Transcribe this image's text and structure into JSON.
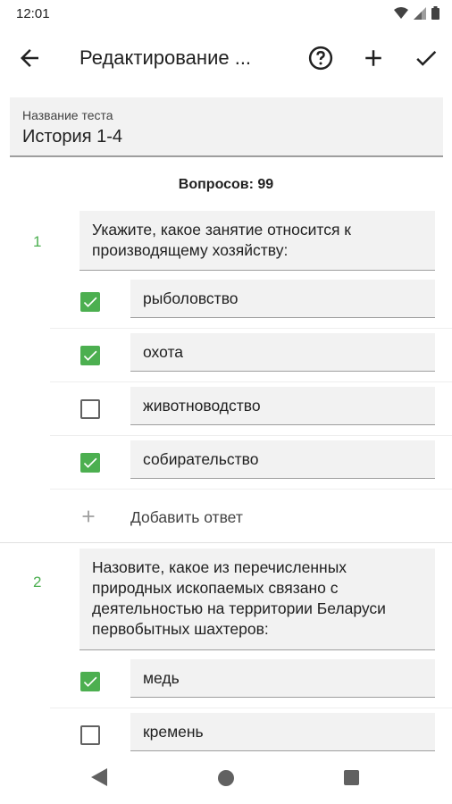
{
  "status_bar": {
    "time": "12:01"
  },
  "app_bar": {
    "title": "Редактирование ..."
  },
  "test_name": {
    "label": "Название теста",
    "value": "История 1-4"
  },
  "question_count": "Вопросов: 99",
  "questions": [
    {
      "number": "1",
      "text": "Укажите, какое занятие относится к производящему хозяйству:",
      "answers": [
        {
          "text": "рыболовство",
          "checked": true
        },
        {
          "text": "охота",
          "checked": true
        },
        {
          "text": "животноводство",
          "checked": false
        },
        {
          "text": "собирательство",
          "checked": true
        }
      ],
      "add_answer_label": "Добавить ответ"
    },
    {
      "number": "2",
      "text": "Назовите, какое из перечисленных природных ископаемых связано с деятельностью на территории Беларуси первобытных шахтеров:",
      "answers": [
        {
          "text": "медь",
          "checked": true
        },
        {
          "text": "кремень",
          "checked": false
        }
      ]
    }
  ],
  "colors": {
    "accent": "#4caf50",
    "field_bg": "#f2f2f2"
  }
}
